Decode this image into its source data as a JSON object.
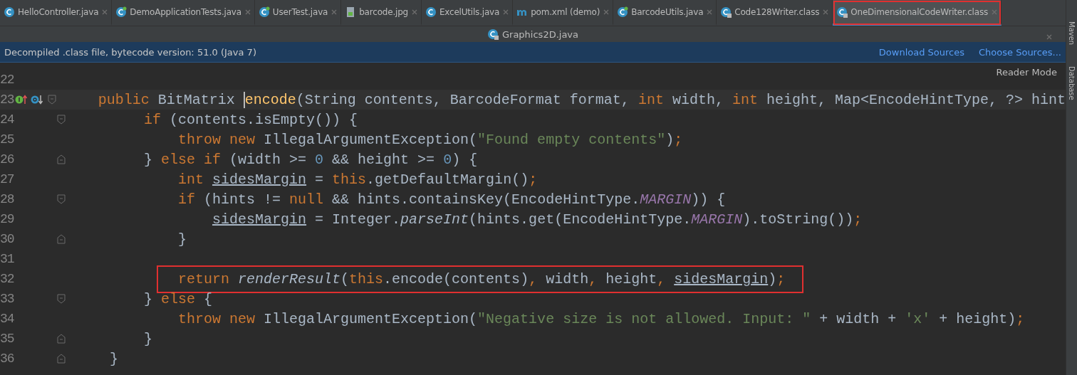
{
  "tabs": [
    {
      "label": "HelloController.java",
      "kind": "class",
      "selected": false
    },
    {
      "label": "DemoApplicationTests.java",
      "kind": "test",
      "selected": false
    },
    {
      "label": "UserTest.java",
      "kind": "test",
      "selected": false
    },
    {
      "label": "barcode.jpg",
      "kind": "image",
      "selected": false
    },
    {
      "label": "ExcelUtils.java",
      "kind": "class",
      "selected": false
    },
    {
      "label": "pom.xml (demo)",
      "kind": "maven",
      "selected": false
    },
    {
      "label": "BarcodeUtils.java",
      "kind": "test",
      "selected": false
    },
    {
      "label": "Code128Writer.class",
      "kind": "compiled",
      "selected": false
    },
    {
      "label": "OneDimensionalCodeWriter.class",
      "kind": "compiled",
      "selected": true,
      "outlined": true
    }
  ],
  "second_tab": {
    "label": "Graphics2D.java",
    "kind": "compiled"
  },
  "banner": {
    "message": "Decompiled .class file, bytecode version: 51.0 (Java 7)",
    "links": [
      "Download Sources",
      "Choose Sources..."
    ]
  },
  "reader_mode": "Reader Mode",
  "side_tools": [
    "Maven",
    "Database"
  ],
  "lines": [
    {
      "number": "22",
      "fold_start": false,
      "fold_end": false
    },
    {
      "number": "23",
      "current": true,
      "fold_start": true,
      "fold_end": false,
      "tokens": [
        {
          "kind": "kw",
          "text": "public "
        },
        {
          "kind": "plain",
          "text": "BitMatrix "
        },
        {
          "kind": "name",
          "text": "encode"
        },
        {
          "kind": "plain",
          "text": "(String contents, BarcodeFormat format, "
        },
        {
          "kind": "kw",
          "text": "int "
        },
        {
          "kind": "plain",
          "text": "width, "
        },
        {
          "kind": "kw",
          "text": "int "
        },
        {
          "kind": "plain",
          "text": "height, Map<EncodeHintType, ?> hint"
        }
      ]
    },
    {
      "number": "24",
      "fold_start": true,
      "fold_end": false,
      "tokens": [
        {
          "kind": "kw",
          "text": "    if "
        },
        {
          "kind": "plain",
          "text": "(contents.isEmpty()) {"
        }
      ]
    },
    {
      "number": "25",
      "fold_start": false,
      "fold_end": false,
      "tokens": [
        {
          "kind": "kw",
          "text": "        throw new "
        },
        {
          "kind": "plain",
          "text": "IllegalArgumentException("
        },
        {
          "kind": "str",
          "text": "\"Found empty contents\""
        },
        {
          "kind": "plain",
          "text": ")"
        },
        {
          "kind": "kw",
          "text": ";"
        }
      ]
    },
    {
      "number": "26",
      "fold_start": false,
      "fold_end": true,
      "tokens": [
        {
          "kind": "plain",
          "text": "    } "
        },
        {
          "kind": "kw",
          "text": "else if "
        },
        {
          "kind": "plain",
          "text": "(width >= "
        },
        {
          "kind": "num",
          "text": "0 "
        },
        {
          "kind": "plain",
          "text": "&& height >= "
        },
        {
          "kind": "num",
          "text": "0"
        },
        {
          "kind": "plain",
          "text": ") {"
        }
      ]
    },
    {
      "number": "27",
      "fold_start": false,
      "fold_end": false,
      "tokens": [
        {
          "kind": "kw",
          "text": "        int "
        },
        {
          "kind": "var",
          "text": "sidesMargin"
        },
        {
          "kind": "plain",
          "text": " = "
        },
        {
          "kind": "kw",
          "text": "this"
        },
        {
          "kind": "plain",
          "text": ".getDefaultMargin()"
        },
        {
          "kind": "kw",
          "text": ";"
        }
      ]
    },
    {
      "number": "28",
      "fold_start": true,
      "fold_end": false,
      "tokens": [
        {
          "kind": "kw",
          "text": "        if "
        },
        {
          "kind": "plain",
          "text": "(hints != "
        },
        {
          "kind": "kw",
          "text": "null "
        },
        {
          "kind": "plain",
          "text": "&& hints.containsKey(EncodeHintType."
        },
        {
          "kind": "const",
          "text": "MARGIN"
        },
        {
          "kind": "plain",
          "text": ")) {"
        }
      ]
    },
    {
      "number": "29",
      "fold_start": false,
      "fold_end": false,
      "tokens": [
        {
          "kind": "var",
          "text": "            sidesMargin"
        },
        {
          "kind": "plain",
          "text": " = Integer."
        },
        {
          "kind": "static",
          "text": "parseInt"
        },
        {
          "kind": "plain",
          "text": "(hints.get(EncodeHintType."
        },
        {
          "kind": "const",
          "text": "MARGIN"
        },
        {
          "kind": "plain",
          "text": ").toString())"
        },
        {
          "kind": "kw",
          "text": ";"
        }
      ]
    },
    {
      "number": "30",
      "fold_start": false,
      "fold_end": true,
      "tokens": [
        {
          "kind": "plain",
          "text": "        }"
        }
      ]
    },
    {
      "number": "31",
      "fold_start": false,
      "fold_end": false
    },
    {
      "number": "32",
      "fold_start": false,
      "fold_end": false,
      "outlined": true,
      "tokens": [
        {
          "kind": "kw",
          "text": "        return "
        },
        {
          "kind": "static",
          "text": "renderResult"
        },
        {
          "kind": "plain",
          "text": "("
        },
        {
          "kind": "kw",
          "text": "this"
        },
        {
          "kind": "plain",
          "text": ".encode(contents)"
        },
        {
          "kind": "kw",
          "text": ", "
        },
        {
          "kind": "plain",
          "text": "width"
        },
        {
          "kind": "kw",
          "text": ", "
        },
        {
          "kind": "plain",
          "text": "height"
        },
        {
          "kind": "kw",
          "text": ", "
        },
        {
          "kind": "var",
          "text": "sidesMargin"
        },
        {
          "kind": "plain",
          "text": ")"
        },
        {
          "kind": "kw",
          "text": ";"
        }
      ]
    },
    {
      "number": "33",
      "fold_start": true,
      "fold_end": false,
      "tokens": [
        {
          "kind": "plain",
          "text": "    } "
        },
        {
          "kind": "kw",
          "text": "else "
        },
        {
          "kind": "plain",
          "text": "{"
        }
      ]
    },
    {
      "number": "34",
      "fold_start": false,
      "fold_end": false,
      "tokens": [
        {
          "kind": "kw",
          "text": "        throw new "
        },
        {
          "kind": "plain",
          "text": "IllegalArgumentException("
        },
        {
          "kind": "str",
          "text": "\"Negative size is not allowed. Input: \" "
        },
        {
          "kind": "plain",
          "text": "+ width + "
        },
        {
          "kind": "str",
          "text": "'x' "
        },
        {
          "kind": "plain",
          "text": "+ height)"
        },
        {
          "kind": "kw",
          "text": ";"
        }
      ]
    },
    {
      "number": "35",
      "fold_start": false,
      "fold_end": true,
      "tokens": [
        {
          "kind": "plain",
          "text": "    }"
        }
      ]
    },
    {
      "number": "36",
      "fold_start": false,
      "fold_end": true,
      "tokens": [
        {
          "kind": "plain",
          "text": "}"
        }
      ]
    }
  ]
}
